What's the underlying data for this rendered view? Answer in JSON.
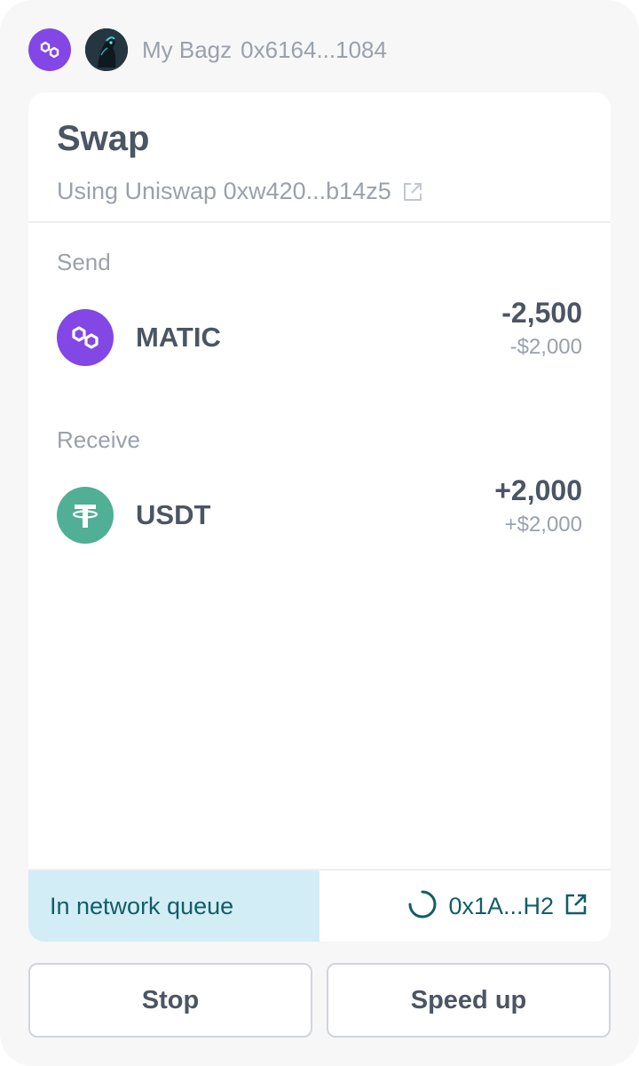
{
  "header": {
    "network_icon": "polygon-icon",
    "account_name": "My Bagz",
    "account_address": "0x6164...1084"
  },
  "card": {
    "title": "Swap",
    "subtitle": "Using Uniswap 0xw420...b14z5",
    "send": {
      "label": "Send",
      "token": "MATIC",
      "icon": "polygon-icon",
      "amount": "-2,500",
      "fiat": "-$2,000"
    },
    "receive": {
      "label": "Receive",
      "token": "USDT",
      "icon": "tether-icon",
      "amount": "+2,000",
      "fiat": "+$2,000"
    },
    "status": {
      "text": "In network queue",
      "tx_hash": "0x1A...H2"
    }
  },
  "actions": {
    "stop_label": "Stop",
    "speed_up_label": "Speed up"
  },
  "colors": {
    "polygon": "#8247e5",
    "tether": "#50af95",
    "status_bg": "#d3edf6",
    "status_text": "#115e67"
  }
}
